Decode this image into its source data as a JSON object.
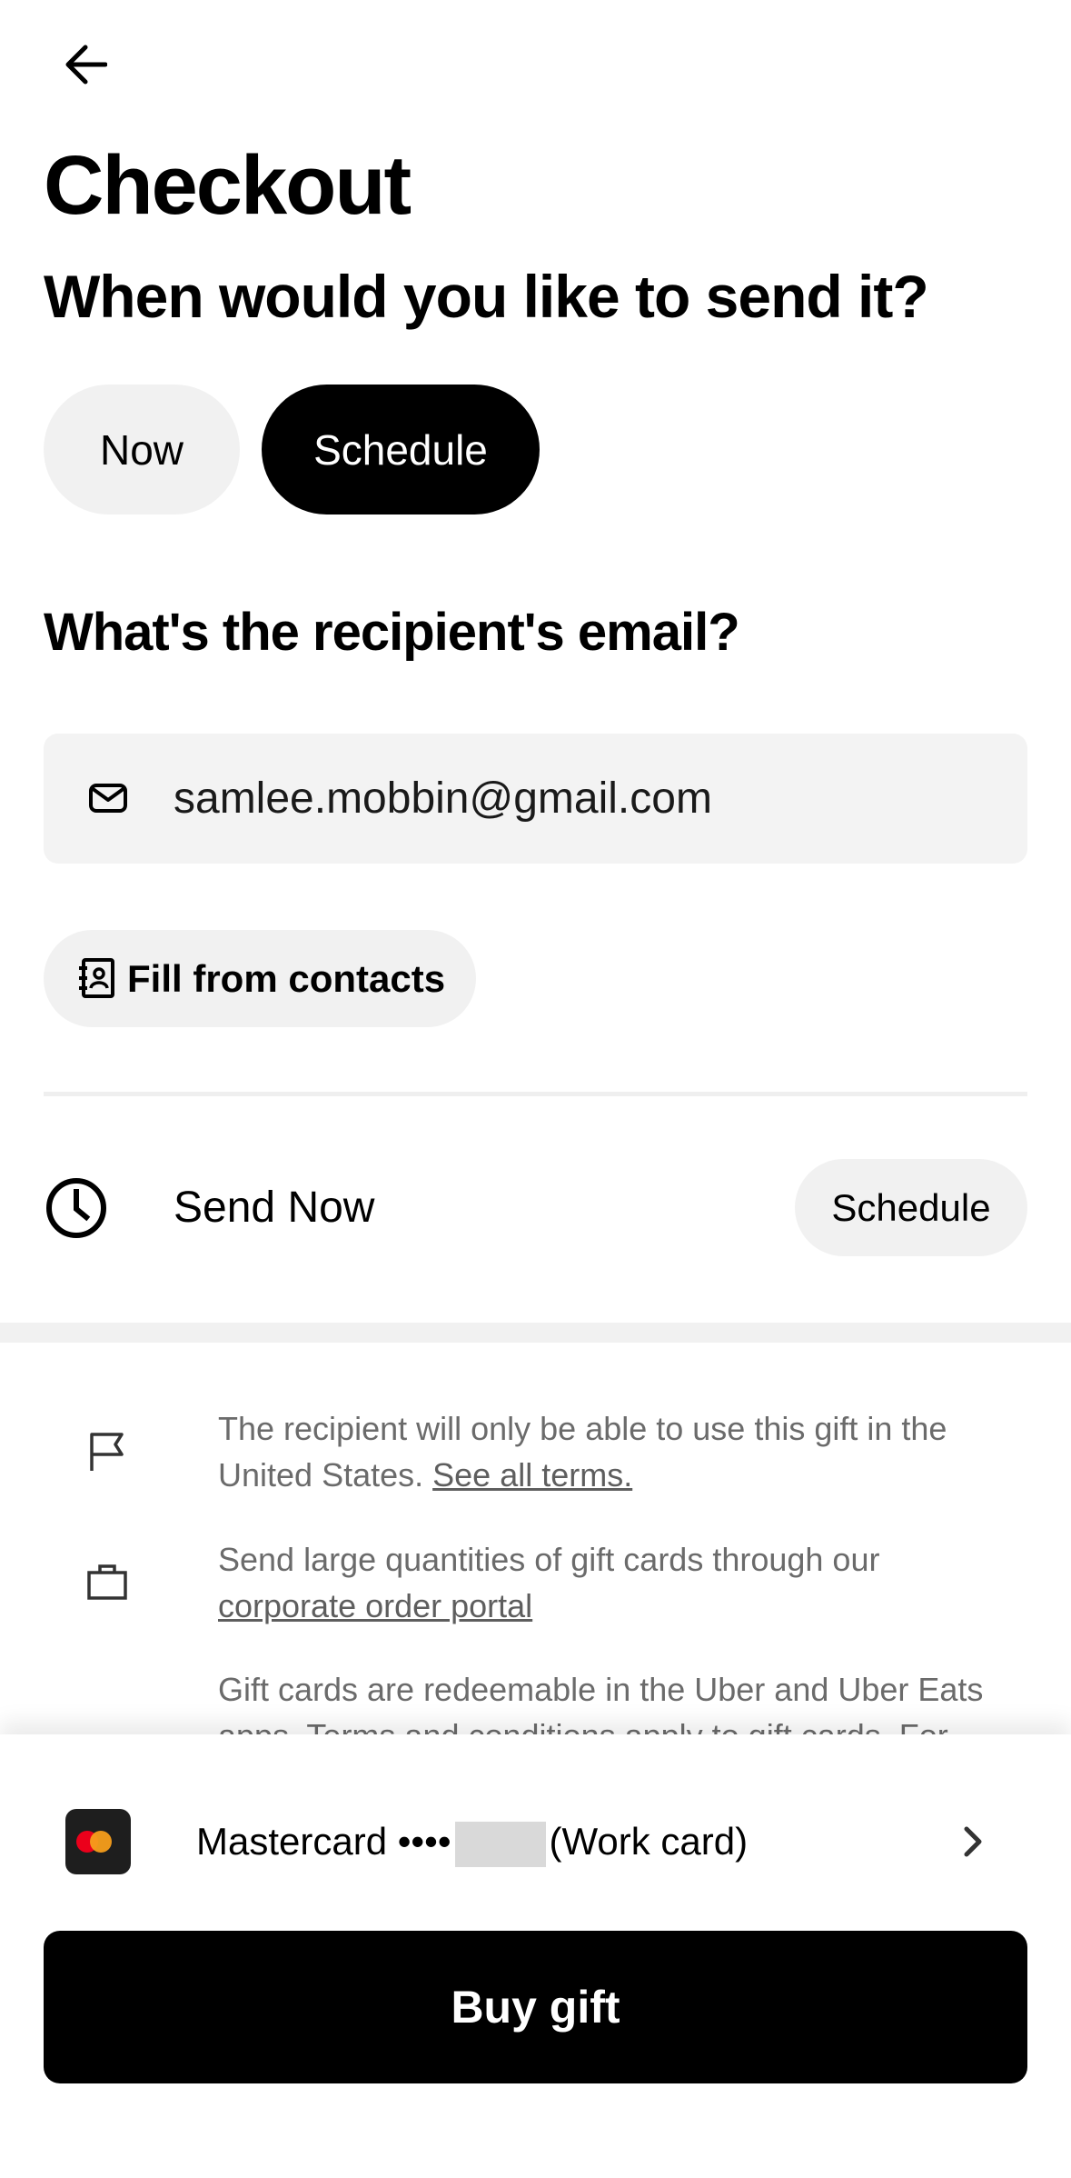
{
  "header": {
    "back_icon": "arrow-left-icon",
    "title": "Checkout"
  },
  "send_time": {
    "question": "When would you like to send it?",
    "options": [
      {
        "label": "Now",
        "selected": false
      },
      {
        "label": "Schedule",
        "selected": true
      }
    ]
  },
  "recipient": {
    "question": "What's the recipient's email?",
    "email_icon": "mail-icon",
    "email_value": "samlee.mobbin@gmail.com",
    "fill_contacts_icon": "contacts-book-icon",
    "fill_contacts_label": "Fill from contacts"
  },
  "send_row": {
    "icon": "clock-icon",
    "label": "Send Now",
    "schedule_label": "Schedule"
  },
  "info": [
    {
      "icon": "flag-icon",
      "text": "The recipient will only be able to use this gift in the United States.",
      "link": "See all terms."
    },
    {
      "icon": "briefcase-icon",
      "text": "Send large quantities of gift cards through our",
      "link": "corporate order portal"
    },
    {
      "icon": "",
      "text": "Gift cards are redeemable in the Uber and Uber Eats apps. Terms and conditions apply to gift cards. For"
    }
  ],
  "payment": {
    "card_icon": "mastercard-icon",
    "card_brand": "Mastercard ••••",
    "card_suffix": "(Work card)",
    "chevron_icon": "chevron-right-icon"
  },
  "buy_button": {
    "label": "Buy gift"
  },
  "colors": {
    "primary": "#000000",
    "pill_bg": "#f1f1f1",
    "muted_text": "#6b6b6b"
  }
}
